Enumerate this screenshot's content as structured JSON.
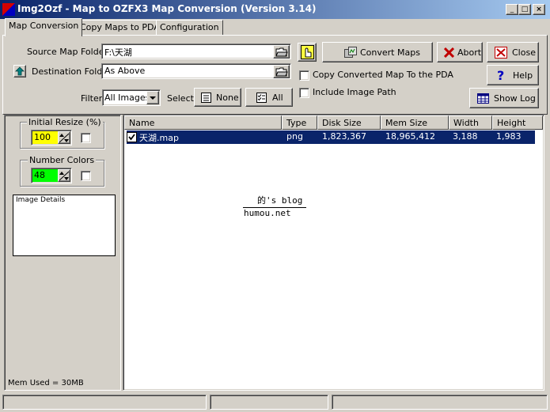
{
  "window": {
    "title": "Img2Ozf - Map to OZFX3 Map Conversion (Version 3.14)",
    "minimize_glyph": "_",
    "maximize_glyph": "□",
    "close_glyph": "×"
  },
  "tabs": [
    {
      "label": "Map Conversion",
      "active": true
    },
    {
      "label": "Copy Maps to PDA",
      "active": false
    },
    {
      "label": "Configuration",
      "active": false
    }
  ],
  "form": {
    "source_label": "Source Map Folder",
    "source_value": "F:\\天湖",
    "dest_label": "Destination Folder",
    "dest_value": "As Above",
    "filter_label": "Filter",
    "filter_value": "All Images",
    "select_label": "Select",
    "none_label": "None",
    "all_label": "All",
    "convert_label": "Convert Maps",
    "abort_label": "Abort",
    "close_label": "Close",
    "help_label": "Help",
    "showlog_label": "Show Log",
    "copy_pda_label": "Copy Converted Map To the PDA",
    "include_path_label": "Include Image Path"
  },
  "left": {
    "resize_label": "Initial Resize (%)",
    "resize_value": "100",
    "colors_label": "Number Colors",
    "colors_value": "48",
    "details_label": "Image Details",
    "mem_used": "Mem Used = 30MB"
  },
  "list": {
    "columns": [
      "Name",
      "Type",
      "Disk Size",
      "Mem Size",
      "Width",
      "Height"
    ],
    "rows": [
      {
        "name": "天湖.map",
        "type": "png",
        "disk_size": "1,823,367",
        "mem_size": "18,965,412",
        "width": "3,188",
        "height": "1,983",
        "checked": true,
        "selected": true
      }
    ]
  },
  "watermark": {
    "line1": "的's blog",
    "line2": "humou.net"
  },
  "colors": {
    "title_start": "#0a246a",
    "title_end": "#a6caf0",
    "face": "#d4d0c8",
    "selection": "#0a246a",
    "resize_bg": "#ffff00",
    "colors_bg": "#00ff00"
  }
}
